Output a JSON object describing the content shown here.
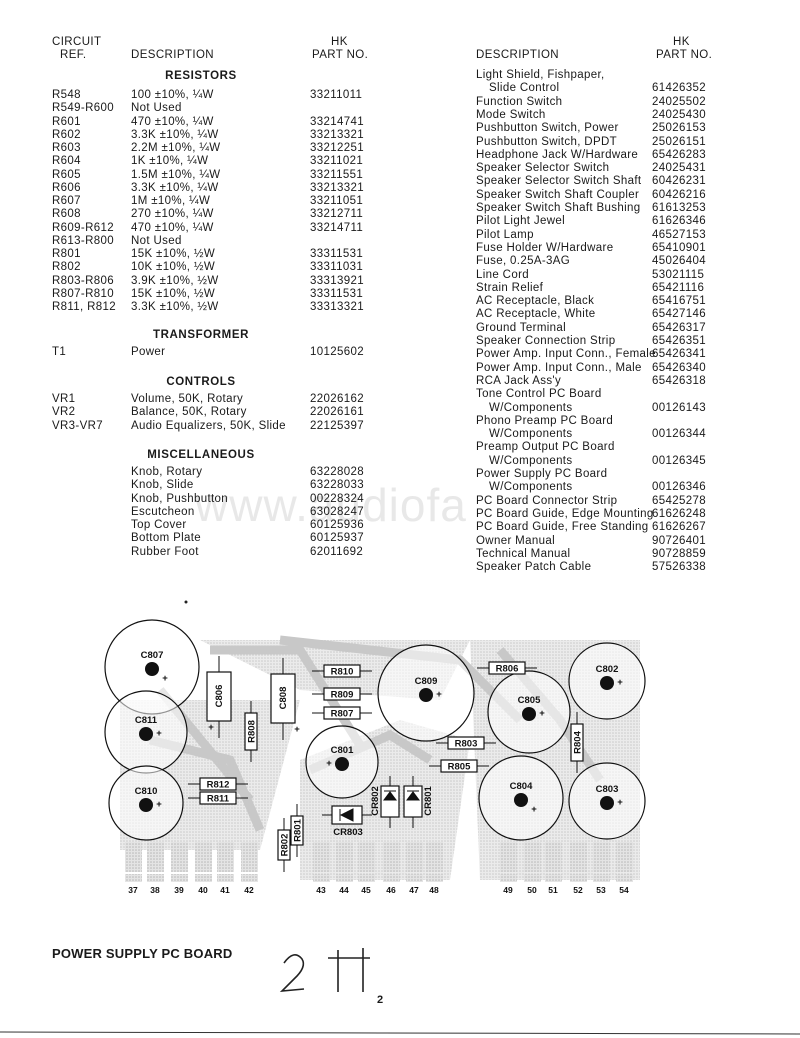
{
  "left": {
    "headers": {
      "ref_line1": "CIRCUIT",
      "ref_line2": "REF.",
      "description": "DESCRIPTION",
      "part_line1": "HK",
      "part_line2": "PART NO."
    },
    "sections": [
      {
        "title": "RESISTORS",
        "rows": [
          {
            "ref": "R548",
            "desc": "100 ±10%, ¼W",
            "part": "33211011"
          },
          {
            "ref": "R549-R600",
            "desc": "Not Used",
            "part": ""
          },
          {
            "ref": "R601",
            "desc": "470 ±10%, ¼W",
            "part": "33214741"
          },
          {
            "ref": "R602",
            "desc": "3.3K ±10%, ¼W",
            "part": "33213321"
          },
          {
            "ref": "R603",
            "desc": "2.2M ±10%, ¼W",
            "part": "33212251"
          },
          {
            "ref": "R604",
            "desc": "1K ±10%, ¼W",
            "part": "33211021"
          },
          {
            "ref": "R605",
            "desc": "1.5M ±10%, ¼W",
            "part": "33211551"
          },
          {
            "ref": "R606",
            "desc": "3.3K ±10%, ¼W",
            "part": "33213321"
          },
          {
            "ref": "R607",
            "desc": "1M ±10%, ¼W",
            "part": "33211051"
          },
          {
            "ref": "R608",
            "desc": "270 ±10%, ¼W",
            "part": "33212711"
          },
          {
            "ref": "R609-R612",
            "desc": "470 ±10%, ¼W",
            "part": "33214711"
          },
          {
            "ref": "R613-R800",
            "desc": "Not Used",
            "part": ""
          },
          {
            "ref": "R801",
            "desc": "15K ±10%, ½W",
            "part": "33311531"
          },
          {
            "ref": "R802",
            "desc": "10K ±10%, ½W",
            "part": "33311031"
          },
          {
            "ref": "R803-R806",
            "desc": "3.9K ±10%, ½W",
            "part": "33313921"
          },
          {
            "ref": "R807-R810",
            "desc": "15K ±10%, ½W",
            "part": "33311531"
          },
          {
            "ref": "R811, R812",
            "desc": "3.3K ±10%, ½W",
            "part": "33313321"
          }
        ]
      },
      {
        "title": "TRANSFORMER",
        "rows": [
          {
            "ref": "T1",
            "desc": "Power",
            "part": "10125602"
          }
        ]
      },
      {
        "title": "CONTROLS",
        "rows": [
          {
            "ref": "VR1",
            "desc": "Volume, 50K, Rotary",
            "part": "22026162"
          },
          {
            "ref": "VR2",
            "desc": "Balance, 50K, Rotary",
            "part": "22026161"
          },
          {
            "ref": "VR3-VR7",
            "desc": "Audio Equalizers, 50K, Slide",
            "part": "22125397"
          }
        ]
      },
      {
        "title": "MISCELLANEOUS",
        "rows": [
          {
            "ref": "",
            "desc": "Knob, Rotary",
            "part": "63228028"
          },
          {
            "ref": "",
            "desc": "Knob, Slide",
            "part": "63228033"
          },
          {
            "ref": "",
            "desc": "Knob, Pushbutton",
            "part": "00228324"
          },
          {
            "ref": "",
            "desc": "Escutcheon",
            "part": "63028247"
          },
          {
            "ref": "",
            "desc": "Top Cover",
            "part": "60125936"
          },
          {
            "ref": "",
            "desc": "Bottom Plate",
            "part": "60125937"
          },
          {
            "ref": "",
            "desc": "Rubber Foot",
            "part": "62011692"
          }
        ]
      }
    ]
  },
  "right": {
    "headers": {
      "description": "DESCRIPTION",
      "part_line1": "HK",
      "part_line2": "PART NO."
    },
    "rows": [
      {
        "desc": [
          "Light Shield, Fishpaper,",
          "Slide Control"
        ],
        "part": "61426352"
      },
      {
        "desc": [
          "Function Switch"
        ],
        "part": "24025502"
      },
      {
        "desc": [
          "Mode Switch"
        ],
        "part": "24025430"
      },
      {
        "desc": [
          "Pushbutton Switch, Power"
        ],
        "part": "25026153"
      },
      {
        "desc": [
          "Pushbutton Switch, DPDT"
        ],
        "part": "25026151"
      },
      {
        "desc": [
          "Headphone Jack W/Hardware"
        ],
        "part": "65426283"
      },
      {
        "desc": [
          "Speaker Selector Switch"
        ],
        "part": "24025431"
      },
      {
        "desc": [
          "Speaker Selector Switch Shaft"
        ],
        "part": "60426231"
      },
      {
        "desc": [
          "Speaker Switch Shaft Coupler"
        ],
        "part": "60426216"
      },
      {
        "desc": [
          "Speaker Switch Shaft Bushing"
        ],
        "part": "61613253"
      },
      {
        "desc": [
          "Pilot Light Jewel"
        ],
        "part": "61626346"
      },
      {
        "desc": [
          "Pilot Lamp"
        ],
        "part": "46527153"
      },
      {
        "desc": [
          "Fuse Holder W/Hardware"
        ],
        "part": "65410901"
      },
      {
        "desc": [
          "Fuse, 0.25A-3AG"
        ],
        "part": "45026404"
      },
      {
        "desc": [
          "Line Cord"
        ],
        "part": "53021115"
      },
      {
        "desc": [
          "Strain Relief"
        ],
        "part": "65421116"
      },
      {
        "desc": [
          "AC Receptacle, Black"
        ],
        "part": "65416751"
      },
      {
        "desc": [
          "AC Receptacle, White"
        ],
        "part": "65427146"
      },
      {
        "desc": [
          "Ground Terminal"
        ],
        "part": "65426317"
      },
      {
        "desc": [
          "Speaker Connection Strip"
        ],
        "part": "65426351"
      },
      {
        "desc": [
          "Power Amp. Input Conn., Female"
        ],
        "part": "65426341"
      },
      {
        "desc": [
          "Power Amp. Input Conn., Male"
        ],
        "part": "65426340"
      },
      {
        "desc": [
          "RCA Jack Ass'y"
        ],
        "part": "65426318"
      },
      {
        "desc": [
          "Tone Control PC Board",
          "W/Components"
        ],
        "part": "00126143"
      },
      {
        "desc": [
          "Phono Preamp PC Board",
          "W/Components"
        ],
        "part": "00126344"
      },
      {
        "desc": [
          "Preamp Output PC Board",
          "W/Components"
        ],
        "part": "00126345"
      },
      {
        "desc": [
          "Power Supply PC Board",
          "W/Components"
        ],
        "part": "00126346"
      },
      {
        "desc": [
          "PC Board Connector Strip"
        ],
        "part": "65425278"
      },
      {
        "desc": [
          "PC Board Guide, Edge Mounting"
        ],
        "part": "61626248"
      },
      {
        "desc": [
          "PC Board Guide, Free Standing"
        ],
        "part": "61626267"
      },
      {
        "desc": [
          "Owner Manual"
        ],
        "part": "90726401"
      },
      {
        "desc": [
          "Technical Manual"
        ],
        "part": "90728859"
      },
      {
        "desc": [
          "Speaker Patch Cable"
        ],
        "part": "57526338"
      }
    ]
  },
  "watermark": "www.audiofa",
  "pcb": {
    "capacitors": [
      "C807",
      "C811",
      "C810",
      "C801",
      "C809",
      "C805",
      "C802",
      "C804",
      "C803"
    ],
    "resistors": [
      "R810",
      "R809",
      "R807",
      "R812",
      "R811",
      "R806",
      "R803",
      "R805",
      "R808",
      "R804",
      "R801",
      "R802"
    ],
    "film_capacitors": [
      "C806",
      "C808"
    ],
    "diodes": [
      "CR803",
      "CR802",
      "CR801"
    ],
    "pins": [
      "37",
      "38",
      "39",
      "40",
      "41",
      "42",
      "43",
      "44",
      "45",
      "46",
      "47",
      "48",
      "49",
      "50",
      "51",
      "52",
      "53",
      "54"
    ],
    "polarity_mark": "+"
  },
  "footer": {
    "title": "POWER SUPPLY PC BOARD",
    "handwritten_note": "2 H",
    "page_number": "2"
  }
}
